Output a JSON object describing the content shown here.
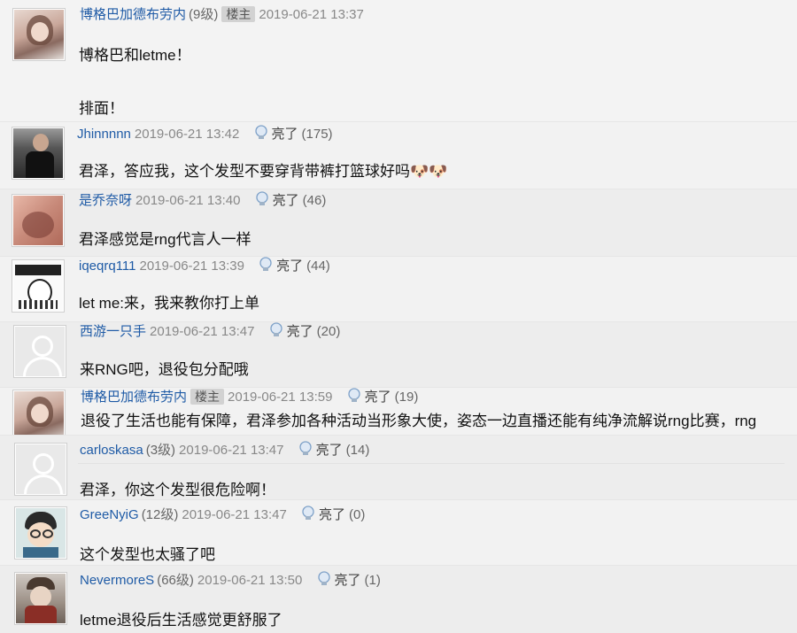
{
  "op": {
    "username": "博格巴加德布劳内",
    "level": "(9级)",
    "owner_badge": "楼主",
    "time": "2019-06-21 13:37",
    "content_line1": "博格巴和letme！",
    "content_line2": "排面！"
  },
  "light_label": "亮了",
  "replies": [
    {
      "username": "Jhinnnnn",
      "level": "",
      "time": "2019-06-21 13:42",
      "count": "(175)",
      "content": "君泽，答应我，这个发型不要穿背带裤打篮球好吗🐶🐶"
    },
    {
      "username": "是乔奈呀",
      "level": "",
      "time": "2019-06-21 13:40",
      "count": "(46)",
      "content": "君泽感觉是rng代言人一样"
    },
    {
      "username": "iqeqrq111",
      "level": "",
      "time": "2019-06-21 13:39",
      "count": "(44)",
      "content": "let me:来，我来教你打上单"
    },
    {
      "username": "西游一只手",
      "level": "",
      "time": "2019-06-21 13:47",
      "count": "(20)",
      "content": "来RNG吧，退役包分配哦"
    },
    {
      "username": "博格巴加德布劳内",
      "level": "",
      "owner_badge": "楼主",
      "time": "2019-06-21 13:59",
      "count": "(19)",
      "content": "退役了生活也能有保障，君泽参加各种活动当形象大使，姿态一边直播还能有纯净流解说rng比赛，rng"
    },
    {
      "username": "carloskasa",
      "level": "(3级)",
      "time": "2019-06-21 13:47",
      "count": "(14)",
      "content": "君泽，你这个发型很危险啊！"
    },
    {
      "username": "GreeNyiG",
      "level": "(12级)",
      "time": "2019-06-21 13:47",
      "count": "(0)",
      "content": "这个发型也太骚了吧"
    },
    {
      "username": "NevermoreS",
      "level": "(66级)",
      "time": "2019-06-21 13:50",
      "count": "(1)",
      "content": "letme退役后生活感觉更舒服了"
    }
  ]
}
